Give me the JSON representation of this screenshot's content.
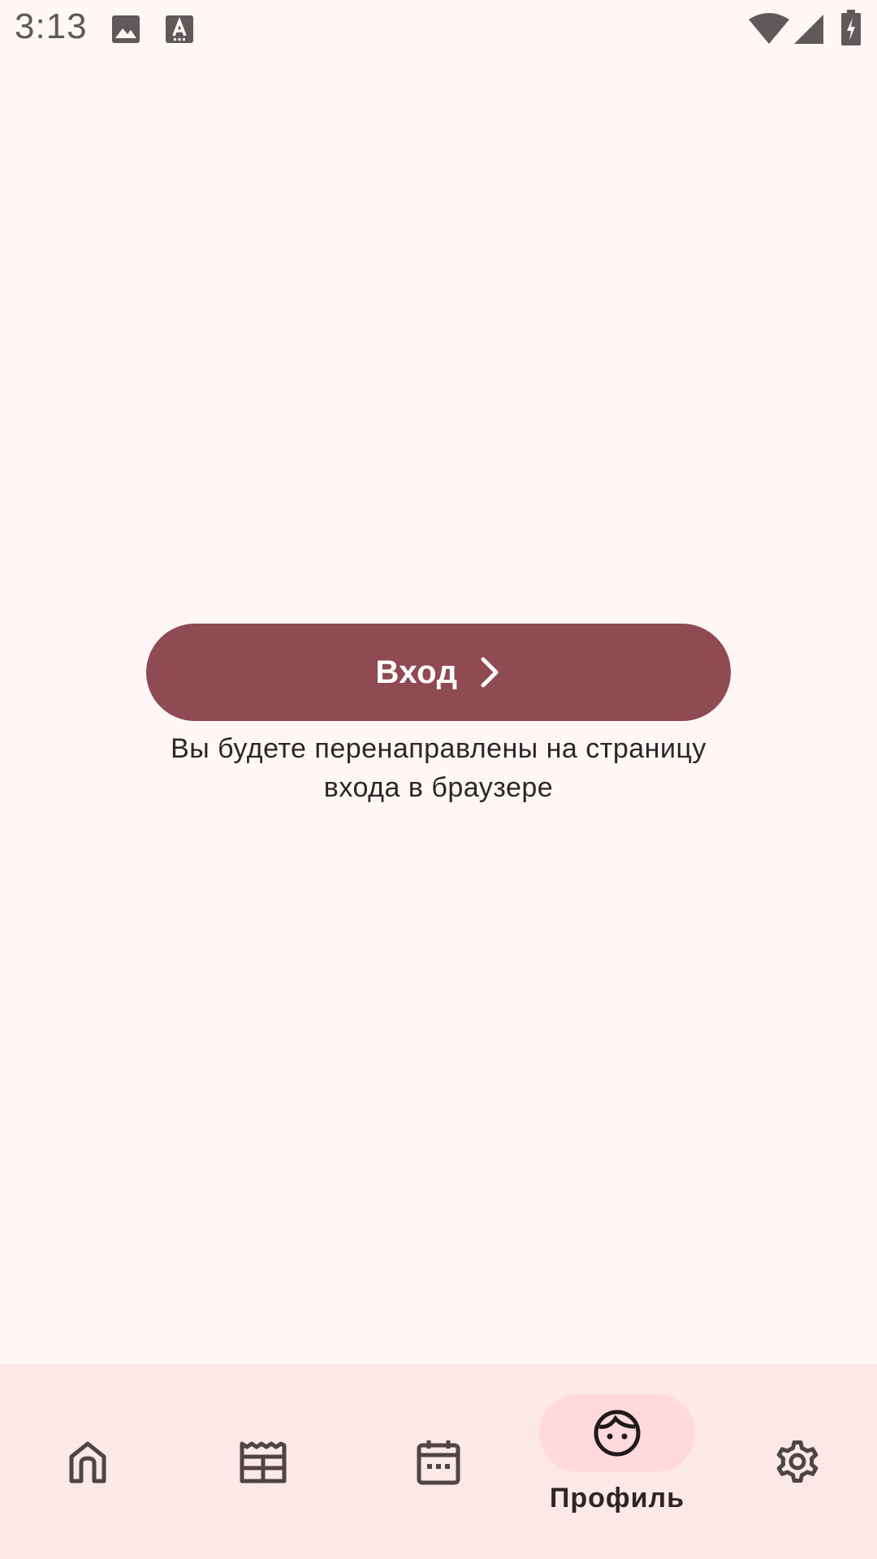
{
  "status_bar": {
    "time": "3:13",
    "left_icons": [
      "image-notification-icon",
      "text-a-notification-icon"
    ],
    "right_icons": [
      "wifi-icon",
      "cellular-signal-icon",
      "battery-charging-icon"
    ]
  },
  "main": {
    "login_button_label": "Вход",
    "login_button_icon": "chevron-right-icon",
    "redirect_note": "Вы будете перенаправлены на страницу входа в браузере"
  },
  "bottom_nav": {
    "items": [
      {
        "icon": "home-icon",
        "label": ""
      },
      {
        "icon": "news-icon",
        "label": ""
      },
      {
        "icon": "calendar-icon",
        "label": ""
      },
      {
        "icon": "face-icon",
        "label": "Профиль",
        "active": true
      },
      {
        "icon": "settings-icon",
        "label": ""
      }
    ]
  },
  "colors": {
    "background": "#fff7f6",
    "primary": "#904a53",
    "nav_background": "#fbe8e7",
    "nav_active_pill": "#ffd9dc",
    "text": "#2e2526",
    "status_icons": "#5f5a5a"
  }
}
